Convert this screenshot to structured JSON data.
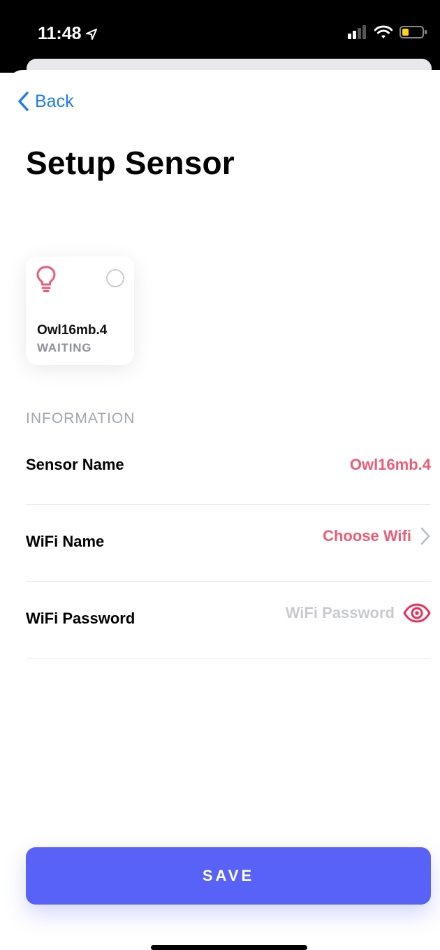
{
  "statusbar": {
    "time": "11:48"
  },
  "nav": {
    "back_label": "Back"
  },
  "page": {
    "title": "Setup Sensor"
  },
  "sensor_card": {
    "name": "Owl16mb.4",
    "status": "WAITING"
  },
  "info": {
    "section_title": "INFORMATION",
    "sensor_name_label": "Sensor Name",
    "sensor_name_value": "Owl16mb.4",
    "wifi_name_label": "WiFi Name",
    "wifi_name_value": "Choose Wifi",
    "wifi_password_label": "WiFi Password",
    "wifi_password_placeholder": "WiFi Password"
  },
  "actions": {
    "save_label": "SAVE"
  },
  "colors": {
    "accent": "#5862f7",
    "pink": "#ee5b74",
    "link_blue": "#1f7cf5"
  }
}
